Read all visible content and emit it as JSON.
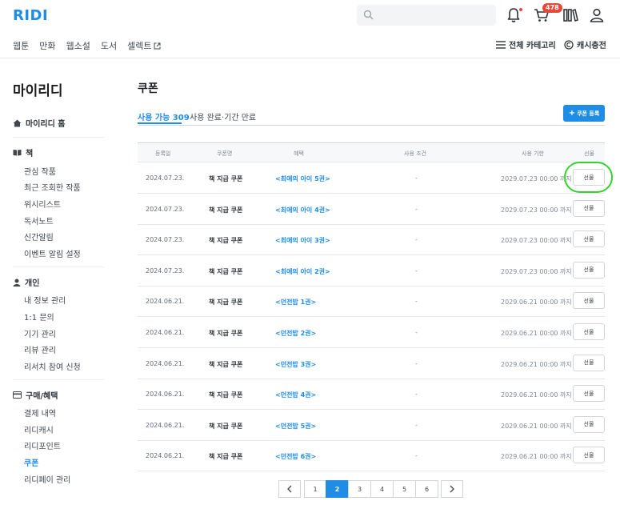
{
  "header": {
    "logo": "RIDI",
    "notification_count": "478",
    "gnb": [
      "웹툰",
      "만화",
      "웹소설",
      "도서",
      "셀렉트"
    ],
    "all_categories": "전체 카테고리",
    "cash_charge": "캐시충전"
  },
  "sidebar": {
    "title": "마이리디",
    "home": "마이리디 홈",
    "sections": [
      {
        "label": "책",
        "items": [
          "관심 작품",
          "최근 조회한 작품",
          "위시리스트",
          "독서노트",
          "신간알림",
          "이벤트 알림 설정"
        ]
      },
      {
        "label": "개인",
        "items": [
          "내 정보 관리",
          "1:1 문의",
          "기기 관리",
          "리뷰 관리",
          "리서치 참여 신청"
        ]
      },
      {
        "label": "구매/혜택",
        "items": [
          "결제 내역",
          "리디캐시",
          "리디포인트",
          "쿠폰",
          "리디페이 관리"
        ]
      }
    ],
    "active_item": "쿠폰"
  },
  "main": {
    "title": "쿠폰",
    "tabs": [
      {
        "label": "사용 가능",
        "count": "309"
      },
      {
        "label": "사용 완료·기간 만료"
      }
    ],
    "register_button": "쿠폰 등록",
    "columns": [
      "등록일",
      "쿠폰명",
      "혜택",
      "사용 조건",
      "사용 기한",
      "선물"
    ],
    "rows": [
      {
        "date": "2024.07.23.",
        "name": "책 지급 쿠폰",
        "benefit": "<최애의 아이 5권>",
        "condition": "-",
        "expiry": "2029.07.23 00:00 까지",
        "gift": "선물"
      },
      {
        "date": "2024.07.23.",
        "name": "책 지급 쿠폰",
        "benefit": "<최애의 아이 4권>",
        "condition": "-",
        "expiry": "2029.07.23 00:00 까지",
        "gift": "선물"
      },
      {
        "date": "2024.07.23.",
        "name": "책 지급 쿠폰",
        "benefit": "<최애의 아이 3권>",
        "condition": "-",
        "expiry": "2029.07.23 00:00 까지",
        "gift": "선물"
      },
      {
        "date": "2024.07.23.",
        "name": "책 지급 쿠폰",
        "benefit": "<최애의 아이 2권>",
        "condition": "-",
        "expiry": "2029.07.23 00:00 까지",
        "gift": "선물"
      },
      {
        "date": "2024.06.21.",
        "name": "책 지급 쿠폰",
        "benefit": "<던전밥 1권>",
        "condition": "-",
        "expiry": "2029.06.21 00:00 까지",
        "gift": "선물"
      },
      {
        "date": "2024.06.21.",
        "name": "책 지급 쿠폰",
        "benefit": "<던전밥 2권>",
        "condition": "-",
        "expiry": "2029.06.21 00:00 까지",
        "gift": "선물"
      },
      {
        "date": "2024.06.21.",
        "name": "책 지급 쿠폰",
        "benefit": "<던전밥 3권>",
        "condition": "-",
        "expiry": "2029.06.21 00:00 까지",
        "gift": "선물"
      },
      {
        "date": "2024.06.21.",
        "name": "책 지급 쿠폰",
        "benefit": "<던전밥 4권>",
        "condition": "-",
        "expiry": "2029.06.21 00:00 까지",
        "gift": "선물"
      },
      {
        "date": "2024.06.21.",
        "name": "책 지급 쿠폰",
        "benefit": "<던전밥 5권>",
        "condition": "-",
        "expiry": "2029.06.21 00:00 까지",
        "gift": "선물"
      },
      {
        "date": "2024.06.21.",
        "name": "책 지급 쿠폰",
        "benefit": "<던전밥 6권>",
        "condition": "-",
        "expiry": "2029.06.21 00:00 까지",
        "gift": "선물"
      }
    ]
  },
  "pagination": {
    "pages": [
      "1",
      "2",
      "3",
      "4",
      "5",
      "6"
    ],
    "current": "2"
  },
  "colors": {
    "accent": "#1f8ce6",
    "badge": "#e64938",
    "highlight": "#32d42a"
  }
}
